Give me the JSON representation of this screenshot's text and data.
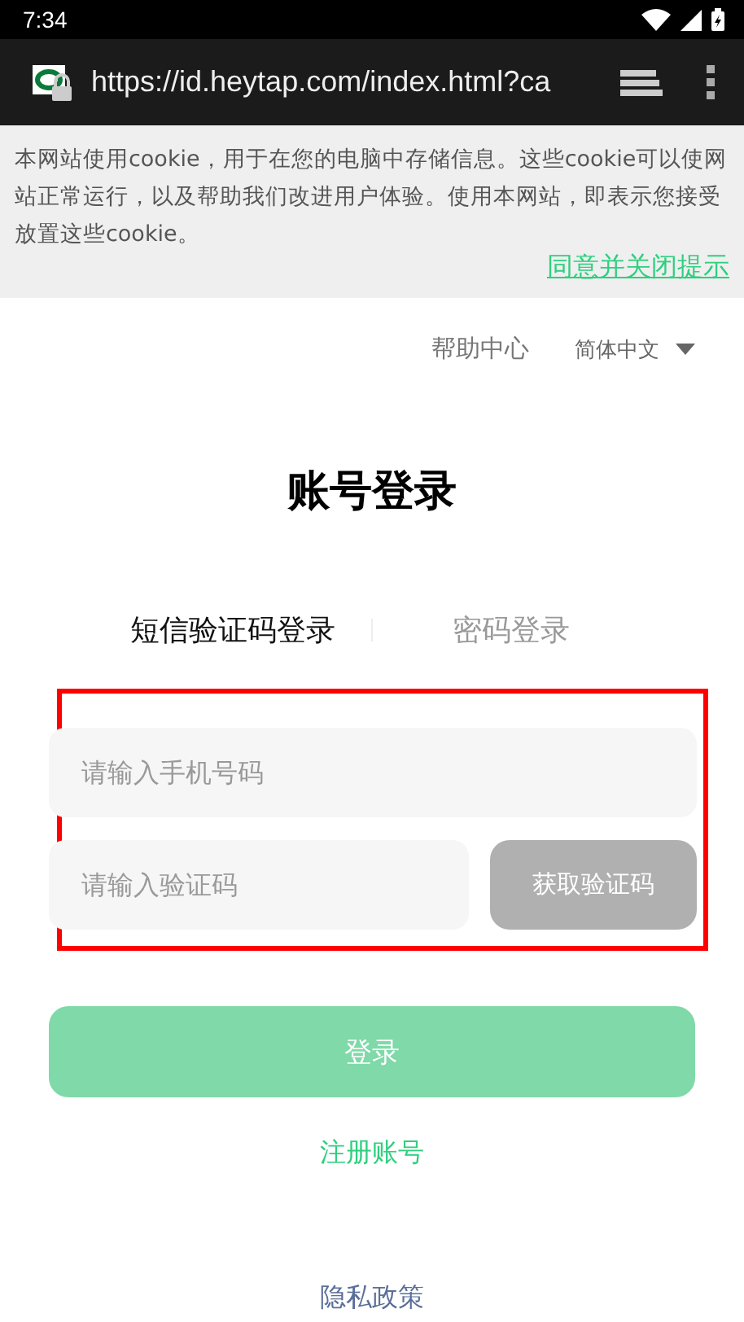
{
  "status_bar": {
    "time": "7:34"
  },
  "browser": {
    "url": "https://id.heytap.com/index.html?ca"
  },
  "cookie_notice": {
    "text": "本网站使用cookie，用于在您的电脑中存储信息。这些cookie可以使网站正常运行，以及帮助我们改进用户体验。使用本网站，即表示您接受放置这些cookie。",
    "action": "同意并关闭提示"
  },
  "top_links": {
    "help": "帮助中心",
    "language": "简体中文"
  },
  "title": "账号登录",
  "tabs": [
    {
      "label": "短信验证码登录",
      "selected": true
    },
    {
      "label": "密码登录",
      "selected": false
    }
  ],
  "highlighted": true,
  "phone_field": {
    "placeholder": "请输入手机号码"
  },
  "code_field": {
    "placeholder": "请输入验证码"
  },
  "get_code_button": {
    "label": "获取验证码",
    "disabled": true
  },
  "login_button": {
    "label": "登录",
    "disabled": true
  },
  "register_link": "注册账号",
  "privacy_link": "隐私政策"
}
